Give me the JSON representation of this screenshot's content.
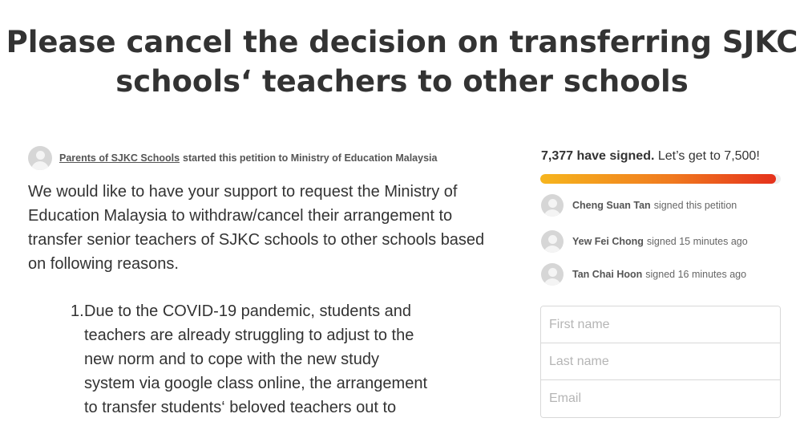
{
  "title_line1": "Please cancel the decision on transferring SJKC",
  "title_line2": "schools‘ teachers to other schools",
  "starter": {
    "name": "Parents of SJKC Schools",
    "text": "started this petition to Ministry of Education Malaysia"
  },
  "body_paragraph": "We would like to have your support to request the Ministry of Education Malaysia to withdraw/cancel their arrangement to transfer senior teachers of SJKC schools to other schools based on following reasons.",
  "reasons": [
    {
      "number": "1.",
      "text": "Due to the COVID-19 pandemic, students and teachers are already struggling to adjust to the new norm and to cope with the new study system via google class online, the arrangement to transfer students‘ beloved teachers out to"
    }
  ],
  "signatures": {
    "count": "7,377 have signed.",
    "goal_text": "Let’s get to 7,500!",
    "progress_fraction": 0.98
  },
  "recent_signers": [
    {
      "name": "Cheng Suan Tan",
      "action": "signed this petition"
    },
    {
      "name": "Yew Fei Chong",
      "action": "signed 15 minutes ago"
    },
    {
      "name": "Tan Chai Hoon",
      "action": "signed 16 minutes ago"
    }
  ],
  "form": {
    "first_name_placeholder": "First name",
    "last_name_placeholder": "Last name",
    "email_placeholder": "Email"
  },
  "colors": {
    "progress_start": "#f6b51e",
    "progress_end": "#e5311c",
    "text": "#333333"
  },
  "icons": [
    "user-avatar-icon"
  ]
}
